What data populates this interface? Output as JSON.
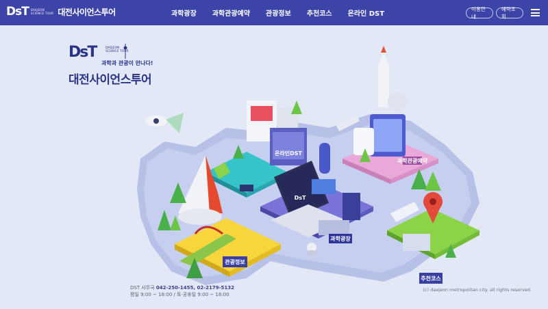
{
  "header": {
    "logo_mark": "DsT",
    "logo_sub": [
      "DAEJEON",
      "SCIENCE TOUR"
    ],
    "logo_title": "대전사이언스투어",
    "nav": [
      "과학광장",
      "과학관광예약",
      "관광정보",
      "추천코스",
      "온라인 DST"
    ],
    "guide_button": "이용안내",
    "reservation_button": "예약조회"
  },
  "hero": {
    "mark": "DsT",
    "sub": [
      "DAEJEON",
      "SCIENCE TOUR"
    ],
    "tagline": "과학과 관광이 만나다!",
    "title": "대전사이언스투어"
  },
  "zones": {
    "online": "온라인DST",
    "reservation": "과학관광예약",
    "science": "과학광장",
    "tourism": "관광정보",
    "course": "추천코스"
  },
  "footer": {
    "office_label": "DST 사무국",
    "phone": "042-250-1455, 02-2179-5132",
    "hours": "평일 9:00 ~ 18:00 / 토·공휴일 9:00 ~ 18:00",
    "copyright": "(c) daejeon metropolitan city. all rights reserved."
  },
  "colors": {
    "header_bg": "#3d44a8",
    "page_bg": "#e3e8f6",
    "brand_navy": "#2b3389"
  }
}
